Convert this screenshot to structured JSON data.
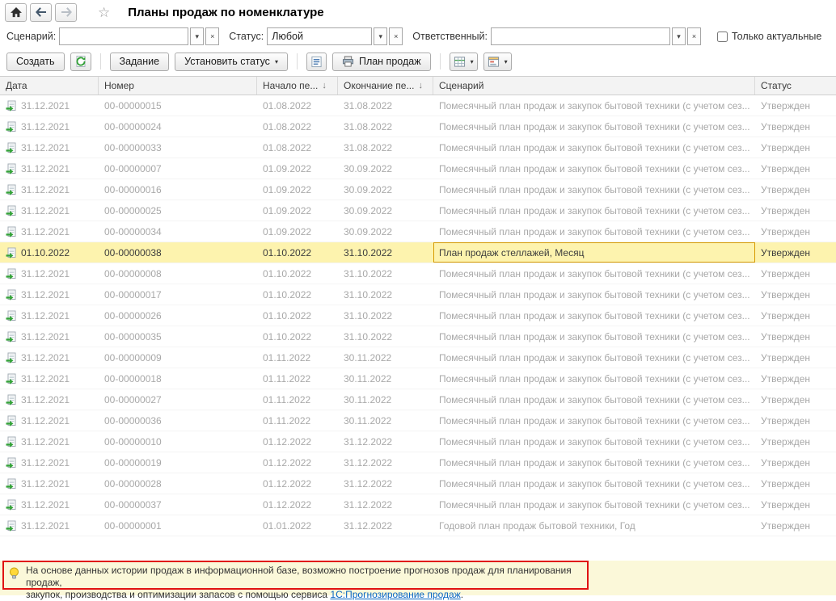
{
  "window": {
    "title": "Планы продаж по номенклатуре"
  },
  "icons": {
    "caret": "▾",
    "clear": "×",
    "star": "☆",
    "sort_desc": "↓"
  },
  "filters": {
    "scenario_label": "Сценарий:",
    "scenario_value": "",
    "status_label": "Статус:",
    "status_value": "Любой",
    "responsible_label": "Ответственный:",
    "responsible_value": "",
    "only_actual_label": "Только актуальные"
  },
  "toolbar": {
    "create_label": "Создать",
    "task_label": "Задание",
    "set_status_label": "Установить статус",
    "sales_plan_label": "План продаж"
  },
  "table": {
    "columns": [
      {
        "label": "Дата",
        "sort": ""
      },
      {
        "label": "Номер",
        "sort": ""
      },
      {
        "label": "Начало пе...",
        "sort": "↓"
      },
      {
        "label": "Окончание пе...",
        "sort": "↓"
      },
      {
        "label": "Сценарий",
        "sort": ""
      },
      {
        "label": "Статус",
        "sort": ""
      }
    ],
    "rows": [
      {
        "date": "31.12.2021",
        "number": "00-00000015",
        "start": "01.08.2022",
        "end": "31.08.2022",
        "scenario": "Помесячный план продаж и закупок бытовой техники (с учетом сез...",
        "status": "Утвержден",
        "selected": false
      },
      {
        "date": "31.12.2021",
        "number": "00-00000024",
        "start": "01.08.2022",
        "end": "31.08.2022",
        "scenario": "Помесячный план продаж и закупок бытовой техники (с учетом сез...",
        "status": "Утвержден",
        "selected": false
      },
      {
        "date": "31.12.2021",
        "number": "00-00000033",
        "start": "01.08.2022",
        "end": "31.08.2022",
        "scenario": "Помесячный план продаж и закупок бытовой техники (с учетом сез...",
        "status": "Утвержден",
        "selected": false
      },
      {
        "date": "31.12.2021",
        "number": "00-00000007",
        "start": "01.09.2022",
        "end": "30.09.2022",
        "scenario": "Помесячный план продаж и закупок бытовой техники (с учетом сез...",
        "status": "Утвержден",
        "selected": false
      },
      {
        "date": "31.12.2021",
        "number": "00-00000016",
        "start": "01.09.2022",
        "end": "30.09.2022",
        "scenario": "Помесячный план продаж и закупок бытовой техники (с учетом сез...",
        "status": "Утвержден",
        "selected": false
      },
      {
        "date": "31.12.2021",
        "number": "00-00000025",
        "start": "01.09.2022",
        "end": "30.09.2022",
        "scenario": "Помесячный план продаж и закупок бытовой техники (с учетом сез...",
        "status": "Утвержден",
        "selected": false
      },
      {
        "date": "31.12.2021",
        "number": "00-00000034",
        "start": "01.09.2022",
        "end": "30.09.2022",
        "scenario": "Помесячный план продаж и закупок бытовой техники (с учетом сез...",
        "status": "Утвержден",
        "selected": false
      },
      {
        "date": "01.10.2022",
        "number": "00-00000038",
        "start": "01.10.2022",
        "end": "31.10.2022",
        "scenario": "План продаж стеллажей, Месяц",
        "status": "Утвержден",
        "selected": true
      },
      {
        "date": "31.12.2021",
        "number": "00-00000008",
        "start": "01.10.2022",
        "end": "31.10.2022",
        "scenario": "Помесячный план продаж и закупок бытовой техники (с учетом сез...",
        "status": "Утвержден",
        "selected": false
      },
      {
        "date": "31.12.2021",
        "number": "00-00000017",
        "start": "01.10.2022",
        "end": "31.10.2022",
        "scenario": "Помесячный план продаж и закупок бытовой техники (с учетом сез...",
        "status": "Утвержден",
        "selected": false
      },
      {
        "date": "31.12.2021",
        "number": "00-00000026",
        "start": "01.10.2022",
        "end": "31.10.2022",
        "scenario": "Помесячный план продаж и закупок бытовой техники (с учетом сез...",
        "status": "Утвержден",
        "selected": false
      },
      {
        "date": "31.12.2021",
        "number": "00-00000035",
        "start": "01.10.2022",
        "end": "31.10.2022",
        "scenario": "Помесячный план продаж и закупок бытовой техники (с учетом сез...",
        "status": "Утвержден",
        "selected": false
      },
      {
        "date": "31.12.2021",
        "number": "00-00000009",
        "start": "01.11.2022",
        "end": "30.11.2022",
        "scenario": "Помесячный план продаж и закупок бытовой техники (с учетом сез...",
        "status": "Утвержден",
        "selected": false
      },
      {
        "date": "31.12.2021",
        "number": "00-00000018",
        "start": "01.11.2022",
        "end": "30.11.2022",
        "scenario": "Помесячный план продаж и закупок бытовой техники (с учетом сез...",
        "status": "Утвержден",
        "selected": false
      },
      {
        "date": "31.12.2021",
        "number": "00-00000027",
        "start": "01.11.2022",
        "end": "30.11.2022",
        "scenario": "Помесячный план продаж и закупок бытовой техники (с учетом сез...",
        "status": "Утвержден",
        "selected": false
      },
      {
        "date": "31.12.2021",
        "number": "00-00000036",
        "start": "01.11.2022",
        "end": "30.11.2022",
        "scenario": "Помесячный план продаж и закупок бытовой техники (с учетом сез...",
        "status": "Утвержден",
        "selected": false
      },
      {
        "date": "31.12.2021",
        "number": "00-00000010",
        "start": "01.12.2022",
        "end": "31.12.2022",
        "scenario": "Помесячный план продаж и закупок бытовой техники (с учетом сез...",
        "status": "Утвержден",
        "selected": false
      },
      {
        "date": "31.12.2021",
        "number": "00-00000019",
        "start": "01.12.2022",
        "end": "31.12.2022",
        "scenario": "Помесячный план продаж и закупок бытовой техники (с учетом сез...",
        "status": "Утвержден",
        "selected": false
      },
      {
        "date": "31.12.2021",
        "number": "00-00000028",
        "start": "01.12.2022",
        "end": "31.12.2022",
        "scenario": "Помесячный план продаж и закупок бытовой техники (с учетом сез...",
        "status": "Утвержден",
        "selected": false
      },
      {
        "date": "31.12.2021",
        "number": "00-00000037",
        "start": "01.12.2022",
        "end": "31.12.2022",
        "scenario": "Помесячный план продаж и закупок бытовой техники (с учетом сез...",
        "status": "Утвержден",
        "selected": false
      },
      {
        "date": "31.12.2021",
        "number": "00-00000001",
        "start": "01.01.2022",
        "end": "31.12.2022",
        "scenario": "Годовой план продаж бытовой техники, Год",
        "status": "Утвержден",
        "selected": false
      }
    ]
  },
  "banner": {
    "line1": "На основе данных истории продаж в информационной базе, возможно построение прогнозов продаж для планирования продаж,",
    "line2": "закупок, производства и оптимизации запасов с помощью сервиса ",
    "link": "1С:Прогнозирование продаж",
    "suffix": "."
  }
}
